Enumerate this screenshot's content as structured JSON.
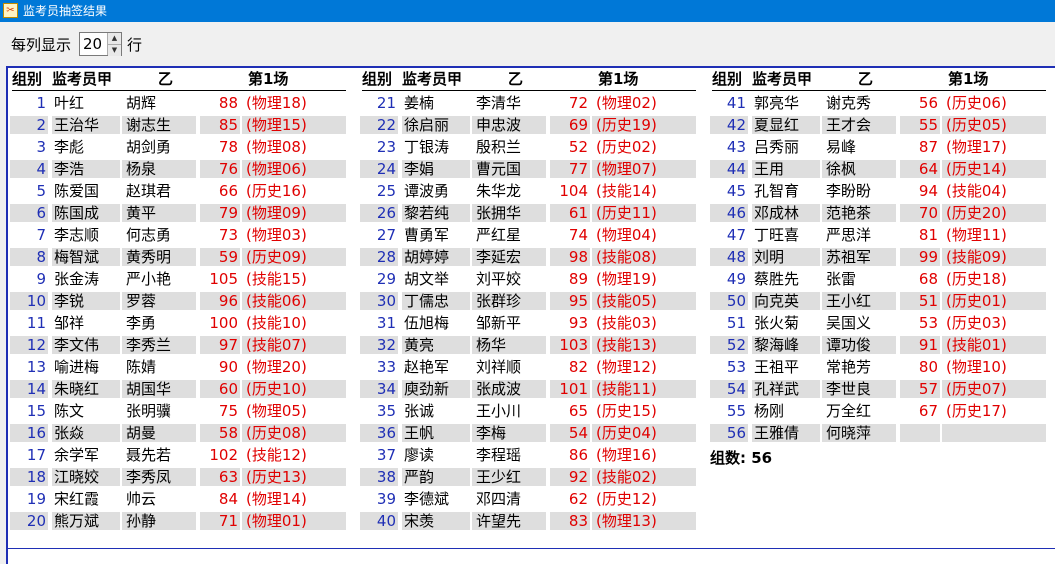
{
  "window": {
    "title": "监考员抽签结果"
  },
  "toolbar": {
    "rows_label_before": "每列显示",
    "rows_value": "20",
    "rows_label_after": "行"
  },
  "header": {
    "group": "组别",
    "a": "监考员甲",
    "b": "乙",
    "session": "第1场"
  },
  "columns": [
    {
      "rows": [
        {
          "no": "1",
          "a": "叶红",
          "b": "胡辉",
          "room": "88",
          "subj": "(物理18)"
        },
        {
          "no": "2",
          "a": "王治华",
          "b": "谢志生",
          "room": "85",
          "subj": "(物理15)"
        },
        {
          "no": "3",
          "a": "李彪",
          "b": "胡剑勇",
          "room": "78",
          "subj": "(物理08)"
        },
        {
          "no": "4",
          "a": "李浩",
          "b": "杨泉",
          "room": "76",
          "subj": "(物理06)"
        },
        {
          "no": "5",
          "a": "陈爱国",
          "b": "赵琪君",
          "room": "66",
          "subj": "(历史16)"
        },
        {
          "no": "6",
          "a": "陈国成",
          "b": "黄平",
          "room": "79",
          "subj": "(物理09)"
        },
        {
          "no": "7",
          "a": "李志顺",
          "b": "何志勇",
          "room": "73",
          "subj": "(物理03)"
        },
        {
          "no": "8",
          "a": "梅智斌",
          "b": "黄秀明",
          "room": "59",
          "subj": "(历史09)"
        },
        {
          "no": "9",
          "a": "张金涛",
          "b": "严小艳",
          "room": "105",
          "subj": "(技能15)"
        },
        {
          "no": "10",
          "a": "李锐",
          "b": "罗蓉",
          "room": "96",
          "subj": "(技能06)"
        },
        {
          "no": "11",
          "a": "邹祥",
          "b": "李勇",
          "room": "100",
          "subj": "(技能10)"
        },
        {
          "no": "12",
          "a": "李文伟",
          "b": "李秀兰",
          "room": "97",
          "subj": "(技能07)"
        },
        {
          "no": "13",
          "a": "喻进梅",
          "b": "陈婧",
          "room": "90",
          "subj": "(物理20)"
        },
        {
          "no": "14",
          "a": "朱晓红",
          "b": "胡国华",
          "room": "60",
          "subj": "(历史10)"
        },
        {
          "no": "15",
          "a": "陈文",
          "b": "张明骥",
          "room": "75",
          "subj": "(物理05)"
        },
        {
          "no": "16",
          "a": "张焱",
          "b": "胡曼",
          "room": "58",
          "subj": "(历史08)"
        },
        {
          "no": "17",
          "a": "余学军",
          "b": "聂先若",
          "room": "102",
          "subj": "(技能12)"
        },
        {
          "no": "18",
          "a": "江晓姣",
          "b": "李秀凤",
          "room": "63",
          "subj": "(历史13)"
        },
        {
          "no": "19",
          "a": "宋红霞",
          "b": "帅云",
          "room": "84",
          "subj": "(物理14)"
        },
        {
          "no": "20",
          "a": "熊万斌",
          "b": "孙静",
          "room": "71",
          "subj": "(物理01)"
        }
      ]
    },
    {
      "rows": [
        {
          "no": "21",
          "a": "姜楠",
          "b": "李清华",
          "room": "72",
          "subj": "(物理02)"
        },
        {
          "no": "22",
          "a": "徐启丽",
          "b": "申忠波",
          "room": "69",
          "subj": "(历史19)"
        },
        {
          "no": "23",
          "a": "丁银涛",
          "b": "殷积兰",
          "room": "52",
          "subj": "(历史02)"
        },
        {
          "no": "24",
          "a": "李娟",
          "b": "曹元国",
          "room": "77",
          "subj": "(物理07)"
        },
        {
          "no": "25",
          "a": "谭波勇",
          "b": "朱华龙",
          "room": "104",
          "subj": "(技能14)"
        },
        {
          "no": "26",
          "a": "黎若纯",
          "b": "张拥华",
          "room": "61",
          "subj": "(历史11)"
        },
        {
          "no": "27",
          "a": "曹勇军",
          "b": "严红星",
          "room": "74",
          "subj": "(物理04)"
        },
        {
          "no": "28",
          "a": "胡婷婷",
          "b": "李延宏",
          "room": "98",
          "subj": "(技能08)"
        },
        {
          "no": "29",
          "a": "胡文举",
          "b": "刘平姣",
          "room": "89",
          "subj": "(物理19)"
        },
        {
          "no": "30",
          "a": "丁儒忠",
          "b": "张群珍",
          "room": "95",
          "subj": "(技能05)"
        },
        {
          "no": "31",
          "a": "伍旭梅",
          "b": "邹新平",
          "room": "93",
          "subj": "(技能03)"
        },
        {
          "no": "32",
          "a": "黄亮",
          "b": "杨华",
          "room": "103",
          "subj": "(技能13)"
        },
        {
          "no": "33",
          "a": "赵艳军",
          "b": "刘祥顺",
          "room": "82",
          "subj": "(物理12)"
        },
        {
          "no": "34",
          "a": "庾劲新",
          "b": "张成波",
          "room": "101",
          "subj": "(技能11)"
        },
        {
          "no": "35",
          "a": "张诚",
          "b": "王小川",
          "room": "65",
          "subj": "(历史15)"
        },
        {
          "no": "36",
          "a": "王帆",
          "b": "李梅",
          "room": "54",
          "subj": "(历史04)"
        },
        {
          "no": "37",
          "a": "廖读",
          "b": "李程瑶",
          "room": "86",
          "subj": "(物理16)"
        },
        {
          "no": "38",
          "a": "严韵",
          "b": "王少红",
          "room": "92",
          "subj": "(技能02)"
        },
        {
          "no": "39",
          "a": "李德斌",
          "b": "邓四清",
          "room": "62",
          "subj": "(历史12)"
        },
        {
          "no": "40",
          "a": "宋羡",
          "b": "许望先",
          "room": "83",
          "subj": "(物理13)"
        }
      ]
    },
    {
      "rows": [
        {
          "no": "41",
          "a": "郭亮华",
          "b": "谢克秀",
          "room": "56",
          "subj": "(历史06)"
        },
        {
          "no": "42",
          "a": "夏显红",
          "b": "王才会",
          "room": "55",
          "subj": "(历史05)"
        },
        {
          "no": "43",
          "a": "吕秀丽",
          "b": "易峰",
          "room": "87",
          "subj": "(物理17)"
        },
        {
          "no": "44",
          "a": "王用",
          "b": "徐枫",
          "room": "64",
          "subj": "(历史14)"
        },
        {
          "no": "45",
          "a": "孔智育",
          "b": "李盼盼",
          "room": "94",
          "subj": "(技能04)"
        },
        {
          "no": "46",
          "a": "邓成林",
          "b": "范艳茶",
          "room": "70",
          "subj": "(历史20)"
        },
        {
          "no": "47",
          "a": "丁旺喜",
          "b": "严思洋",
          "room": "81",
          "subj": "(物理11)"
        },
        {
          "no": "48",
          "a": "刘明",
          "b": "苏祖军",
          "room": "99",
          "subj": "(技能09)"
        },
        {
          "no": "49",
          "a": "蔡胜先",
          "b": "张雷",
          "room": "68",
          "subj": "(历史18)"
        },
        {
          "no": "50",
          "a": "向克英",
          "b": "王小红",
          "room": "51",
          "subj": "(历史01)"
        },
        {
          "no": "51",
          "a": "张火菊",
          "b": "吴国义",
          "room": "53",
          "subj": "(历史03)"
        },
        {
          "no": "52",
          "a": "黎海峰",
          "b": "谭功俊",
          "room": "91",
          "subj": "(技能01)"
        },
        {
          "no": "53",
          "a": "王祖平",
          "b": "常艳芳",
          "room": "80",
          "subj": "(物理10)"
        },
        {
          "no": "54",
          "a": "孔祥武",
          "b": "李世良",
          "room": "57",
          "subj": "(历史07)"
        },
        {
          "no": "55",
          "a": "杨刚",
          "b": "万全红",
          "room": "67",
          "subj": "(历史17)"
        },
        {
          "no": "56",
          "a": "王雅倩",
          "b": "何晓萍",
          "room": "",
          "subj": ""
        }
      ]
    }
  ],
  "summary": {
    "count_label": "组数: 56"
  }
}
